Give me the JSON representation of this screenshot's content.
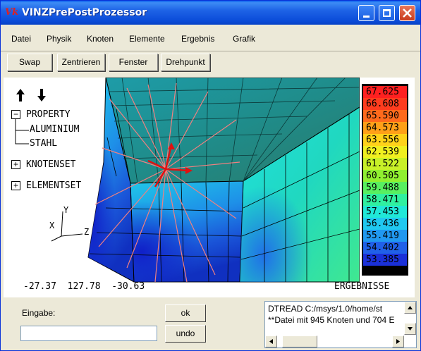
{
  "window": {
    "title": "VINZPrePostProzessor",
    "icon_text": "Vk"
  },
  "menu": [
    "Datei",
    "Physik",
    "Knoten",
    "Elemente",
    "Ergebnis",
    "Grafik"
  ],
  "toolbar": [
    "Swap",
    "Zentrieren",
    "Fenster",
    "Drehpunkt"
  ],
  "tree": {
    "property": "PROPERTY",
    "children": [
      "ALUMINIUM",
      "STAHL"
    ],
    "knotenset": "KNOTENSET",
    "elementset": "ELEMENTSET",
    "collapse_sign": "−",
    "expand_sign": "+"
  },
  "axes": {
    "x": "X",
    "y": "Y",
    "z": "Z"
  },
  "coords": "-27.37  127.78  -30.63",
  "result_label": "ERGEBNISSE",
  "legend": {
    "values": [
      "67.625",
      "66.608",
      "65.590",
      "64.573",
      "63.556",
      "62.539",
      "61.522",
      "60.505",
      "59.488",
      "58.471",
      "57.453",
      "56.436",
      "55.419",
      "54.402",
      "53.385"
    ],
    "colors": [
      "#FF2020",
      "#FF3C1E",
      "#FF6A1C",
      "#FFA018",
      "#FFD21A",
      "#F0F020",
      "#C8F028",
      "#90F030",
      "#58F060",
      "#30F0A0",
      "#20E8D8",
      "#20C8F0",
      "#2098F0",
      "#2060E8",
      "#1A30D8"
    ]
  },
  "input": {
    "label": "Eingabe:",
    "value": ""
  },
  "buttons": {
    "ok": "ok",
    "undo": "undo"
  },
  "log": [
    "DTREAD C:/msys/1.0/home/st",
    "**Datei mit 945 Knoten und 704 E"
  ]
}
